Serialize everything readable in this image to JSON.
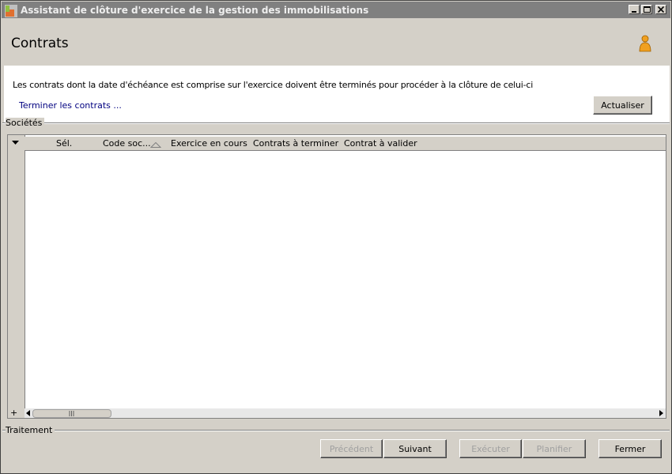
{
  "window": {
    "title": "Assistant de clôture d'exercice de la gestion des immobilisations",
    "colors": {
      "titlebar": "#808080",
      "background": "#d4d0c8",
      "link": "#000080"
    }
  },
  "header": {
    "title": "Contrats",
    "icon": "user-icon"
  },
  "content": {
    "info_text": "Les contrats dont la date d'échéance est comprise sur l'exercice doivent être terminés pour procéder à la clôture de celui-ci",
    "link_text": "Terminer les contrats ...",
    "refresh_button": "Actualiser"
  },
  "societes": {
    "label": "Sociétés",
    "grid": {
      "expander_add": "+",
      "columns": [
        "Sél.",
        "Code soc...",
        "Exercice en cours",
        "Contrats à terminer",
        "Contrat à valider"
      ],
      "sorted_column": "Code soc...",
      "rows": []
    }
  },
  "traitement": {
    "label": "Traitement",
    "buttons": {
      "previous": "Précédent",
      "next": "Suivant",
      "execute": "Exécuter",
      "plan": "Planifier",
      "close": "Fermer"
    }
  }
}
